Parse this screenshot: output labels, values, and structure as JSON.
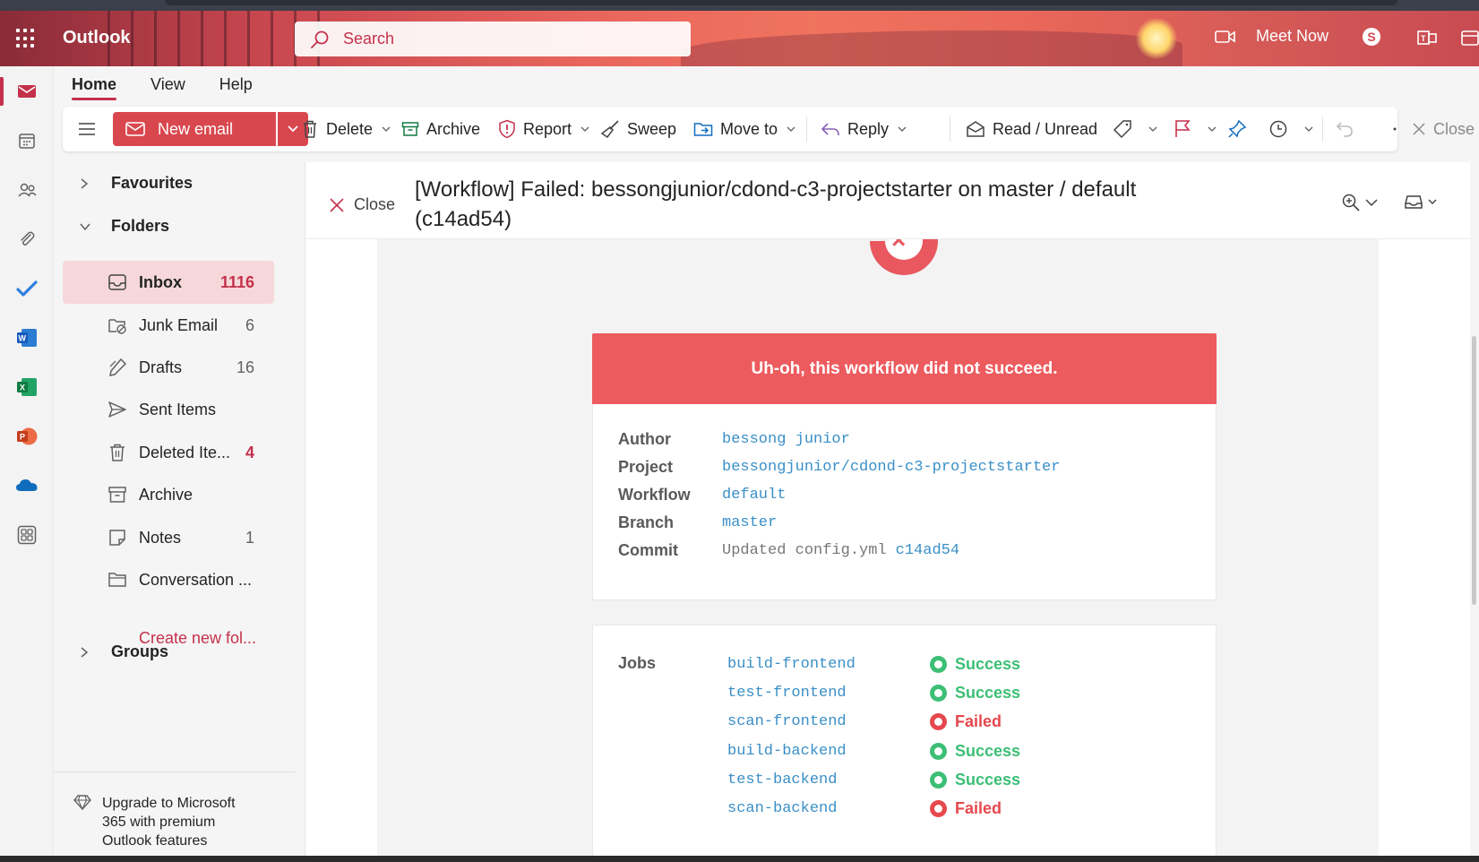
{
  "header": {
    "app_name": "Outlook",
    "search_placeholder": "Search",
    "meet_now": "Meet Now"
  },
  "tabs": [
    {
      "label": "Home",
      "active": true
    },
    {
      "label": "View",
      "active": false
    },
    {
      "label": "Help",
      "active": false
    }
  ],
  "ribbon": {
    "new_email": "New email",
    "delete": "Delete",
    "archive": "Archive",
    "report": "Report",
    "sweep": "Sweep",
    "move_to": "Move to",
    "reply": "Reply",
    "read_unread": "Read / Unread",
    "close": "Close"
  },
  "folders": {
    "favourites": "Favourites",
    "folders_label": "Folders",
    "items": [
      {
        "name": "Inbox",
        "count": "1116",
        "icon": "inbox-icon"
      },
      {
        "name": "Junk Email",
        "count": "6",
        "icon": "junk-icon"
      },
      {
        "name": "Drafts",
        "count": "16",
        "icon": "drafts-icon"
      },
      {
        "name": "Sent Items",
        "count": "",
        "icon": "sent-icon"
      },
      {
        "name": "Deleted Ite...",
        "count": "4",
        "icon": "trash-icon"
      },
      {
        "name": "Archive",
        "count": "",
        "icon": "archive-icon"
      },
      {
        "name": "Notes",
        "count": "1",
        "icon": "notes-icon"
      },
      {
        "name": "Conversation ...",
        "count": "",
        "icon": "folder-icon"
      }
    ],
    "create_new": "Create new fol...",
    "groups": "Groups",
    "upgrade": "Upgrade to Microsoft 365 with premium Outlook features"
  },
  "message": {
    "close_label": "Close",
    "subject": "[Workflow] Failed: bessongjunior/cdond-c3-projectstarter on master / default (c14ad54)",
    "banner": "Uh-oh, this workflow did not succeed.",
    "meta": [
      {
        "key": "Author",
        "value": "bessong junior"
      },
      {
        "key": "Project",
        "value": "bessongjunior/cdond-c3-projectstarter"
      },
      {
        "key": "Workflow",
        "value": "default"
      },
      {
        "key": "Branch",
        "value": "master"
      }
    ],
    "commit_label": "Commit",
    "commit_message": "Updated config.yml",
    "commit_hash": "c14ad54",
    "jobs_label": "Jobs",
    "jobs": [
      {
        "name": "build-frontend",
        "status": "Success"
      },
      {
        "name": "test-frontend",
        "status": "Success"
      },
      {
        "name": "scan-frontend",
        "status": "Failed"
      },
      {
        "name": "build-backend",
        "status": "Success"
      },
      {
        "name": "test-backend",
        "status": "Success"
      },
      {
        "name": "scan-backend",
        "status": "Failed"
      }
    ]
  },
  "colors": {
    "accent": "#c4314b",
    "banner": "#ec5b5e",
    "success": "#3cbf75",
    "failed": "#e5484d",
    "link": "#3a8fc7"
  }
}
